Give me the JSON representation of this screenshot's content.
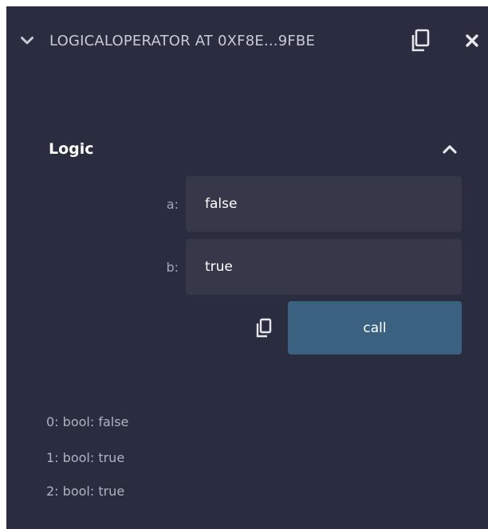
{
  "header": {
    "contract_title": "LOGICALOPERATOR AT 0XF8E...9FBE",
    "collapse_icon": "chevron-down-icon",
    "copy_icon": "copy-icon",
    "close_icon": "close-icon"
  },
  "function": {
    "name": "Logic",
    "toggle_icon": "chevron-up-icon",
    "params": [
      {
        "label": "a:",
        "value": "false"
      },
      {
        "label": "b:",
        "value": "true"
      }
    ],
    "call_label": "call",
    "copy_calldata_icon": "copy-icon"
  },
  "results": [
    {
      "index": "0:",
      "value": "bool: false"
    },
    {
      "index": "1:",
      "value": "bool: true"
    },
    {
      "index": "2:",
      "value": "bool: true"
    }
  ],
  "colors": {
    "panel_bg": "#2a2c3f",
    "input_bg": "#363849",
    "call_button_bg": "#3b6180"
  }
}
